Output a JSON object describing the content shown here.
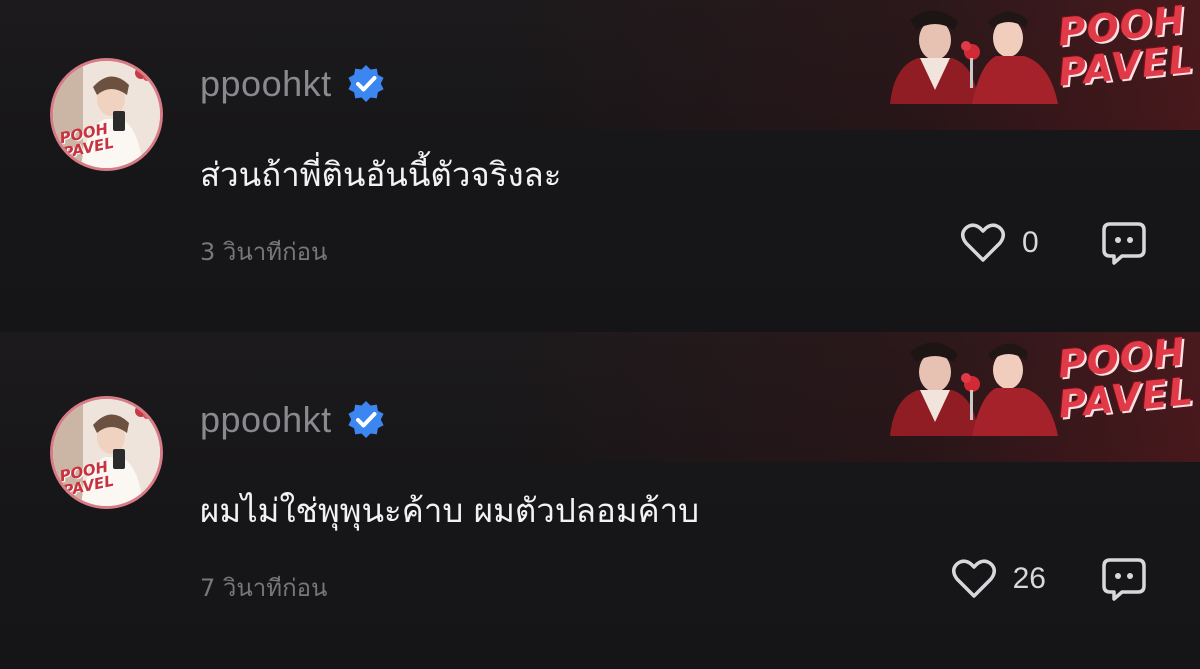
{
  "colors": {
    "background": "#151517",
    "username": "#8a8a8e",
    "text": "#f2f2f2",
    "meta": "#77777b",
    "verified": "#3b86f0",
    "brand_red": "#e03a48"
  },
  "comments": [
    {
      "username": "ppoohkt",
      "verified_icon": "verified-badge-icon",
      "avatar_brand": "POOH\nPAVEL",
      "banner_logo": "POOH\nPAVEL",
      "text": "ส่วนถ้าพี่ตินอันนี้ตัวจริงละ",
      "time": "3 วินาทีก่อน",
      "like_icon": "heart-icon",
      "likes": "0",
      "reply_icon": "comment-bubble-icon"
    },
    {
      "username": "ppoohkt",
      "verified_icon": "verified-badge-icon",
      "avatar_brand": "POOH\nPAVEL",
      "banner_logo": "POOH\nPAVEL",
      "text": "ผมไม่ใช่พุพุนะค้าบ ผมตัวปลอมค้าบ",
      "time": "7 วินาทีก่อน",
      "like_icon": "heart-icon",
      "likes": "26",
      "reply_icon": "comment-bubble-icon"
    }
  ]
}
